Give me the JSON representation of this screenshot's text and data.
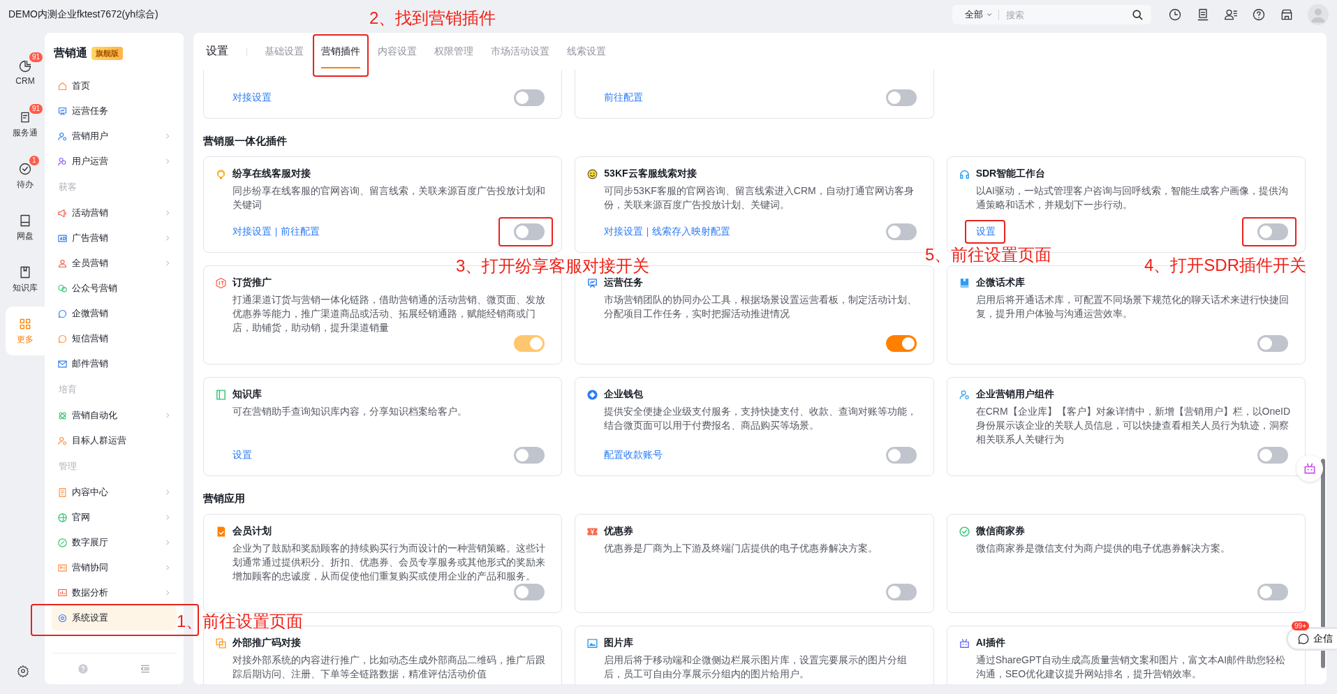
{
  "header": {
    "company": "DEMO内测企业fktest7672(yh综合)",
    "search": {
      "scope": "全部",
      "placeholder": "搜索"
    }
  },
  "rail": [
    {
      "label": "CRM",
      "badge": "91",
      "selected": false
    },
    {
      "label": "服务通",
      "badge": "91",
      "selected": false
    },
    {
      "label": "待办",
      "badge": "1",
      "selected": false
    },
    {
      "label": "网盘",
      "selected": false
    },
    {
      "label": "知识库",
      "selected": false
    },
    {
      "label": "更多",
      "selected": true
    }
  ],
  "nav": {
    "title": "营销通",
    "edition": "旗舰版",
    "groups": [
      {
        "items": [
          {
            "label": "首页",
            "expandable": false,
            "selected": false
          },
          {
            "label": "运营任务",
            "expandable": false,
            "selected": false
          },
          {
            "label": "营销用户",
            "expandable": true,
            "selected": false
          },
          {
            "label": "用户运营",
            "expandable": true,
            "selected": false
          }
        ]
      },
      {
        "label": "获客",
        "items": [
          {
            "label": "活动营销",
            "expandable": true,
            "selected": false
          },
          {
            "label": "广告营销",
            "expandable": true,
            "selected": false
          },
          {
            "label": "全员营销",
            "expandable": true,
            "selected": false
          },
          {
            "label": "公众号营销",
            "expandable": false,
            "selected": false
          },
          {
            "label": "企微营销",
            "expandable": false,
            "selected": false
          },
          {
            "label": "短信营销",
            "expandable": false,
            "selected": false
          },
          {
            "label": "邮件营销",
            "expandable": false,
            "selected": false
          }
        ]
      },
      {
        "label": "培育",
        "items": [
          {
            "label": "营销自动化",
            "expandable": true,
            "selected": false
          },
          {
            "label": "目标人群运营",
            "expandable": false,
            "selected": false
          }
        ]
      },
      {
        "label": "管理",
        "items": [
          {
            "label": "内容中心",
            "expandable": true,
            "selected": false
          },
          {
            "label": "官网",
            "expandable": true,
            "selected": false
          },
          {
            "label": "数字展厅",
            "expandable": true,
            "selected": false
          },
          {
            "label": "营销协同",
            "expandable": true,
            "selected": false
          },
          {
            "label": "数据分析",
            "expandable": true,
            "selected": false
          },
          {
            "label": "系统设置",
            "expandable": false,
            "selected": true,
            "marked": true
          }
        ]
      }
    ]
  },
  "tabs": {
    "title": "设置",
    "items": [
      {
        "label": "基础设置",
        "selected": false
      },
      {
        "label": "营销插件",
        "selected": true,
        "marked": true
      },
      {
        "label": "内容设置",
        "selected": false
      },
      {
        "label": "权限管理",
        "selected": false
      },
      {
        "label": "市场活动设置",
        "selected": false
      },
      {
        "label": "线索设置",
        "selected": false
      }
    ]
  },
  "sections": [
    {
      "clipped": true,
      "cards": [
        {
          "links": [
            {
              "text": "对接设置"
            }
          ],
          "toggle": {
            "on": false
          }
        },
        {
          "links": [
            {
              "text": "前往配置"
            }
          ],
          "toggle": {
            "on": false
          }
        }
      ]
    },
    {
      "title": "营销服一体化插件",
      "cards": [
        {
          "title": "纷享在线客服对接",
          "description": "同步纷享在线客服的官网咨询、留言线索，关联来源百度广告投放计划和关键词",
          "links": [
            {
              "text": "对接设置"
            },
            {
              "text": "前往配置"
            }
          ],
          "toggle": {
            "on": false,
            "marked": true
          }
        },
        {
          "title": "53KF云客服线索对接",
          "description": "可同步53KF客服的官网咨询、留言线索进入CRM，自动打通官网访客身份，关联来源百度广告投放计划、关键词。",
          "links": [
            {
              "text": "对接设置"
            },
            {
              "text": "线索存入映射配置"
            }
          ],
          "toggle": {
            "on": false
          }
        },
        {
          "title": "SDR智能工作台",
          "description": "以AI驱动，一站式管理客户咨询与回呼线索，智能生成客户画像，提供沟通策略和话术，并规划下一步行动。",
          "links": [
            {
              "text": "设置",
              "marked": true
            }
          ],
          "toggle": {
            "on": false,
            "marked": true
          }
        },
        {
          "title": "订货推广",
          "description": "打通渠道订货与营销一体化链路，借助营销通的活动营销、微页面、发放优惠券等能力，推广渠道商品或活动、拓展经销通路，赋能经销商或门店，助铺货，助动销，提升渠道销量",
          "toggle": {
            "on": true,
            "disabled": true
          }
        },
        {
          "title": "运营任务",
          "description": "市场营销团队的协同办公工具，根据场景设置运营看板，制定活动计划、分配项目工作任务，实时把握活动推进情况",
          "toggle": {
            "on": true
          }
        },
        {
          "title": "企微话术库",
          "description": "启用后将开通话术库，可配置不同场景下规范化的聊天话术来进行快捷回复，提升用户体验与沟通运营效率。",
          "toggle": {
            "on": false
          }
        },
        {
          "title": "知识库",
          "description": "可在营销助手查询知识库内容，分享知识档案给客户。",
          "links": [
            {
              "text": "设置"
            }
          ],
          "toggle": {
            "on": false
          }
        },
        {
          "title": "企业钱包",
          "description": "提供安全便捷企业级支付服务，支持快捷支付、收款、查询对账等功能，结合微页面可以用于付费报名、商品购买等场景。",
          "links": [
            {
              "text": "配置收款账号"
            }
          ],
          "toggle": {
            "on": false
          }
        },
        {
          "title": "企业营销用户组件",
          "description": "在CRM【企业库】【客户】对象详情中，新增【营销用户】栏，以OneID身份展示该企业的关联人员信息，可以快捷查看相关人员行为轨迹，洞察相关联系人关键行为",
          "toggle": {
            "on": false
          }
        }
      ]
    },
    {
      "title": "营销应用",
      "cards": [
        {
          "title": "会员计划",
          "description": "企业为了鼓励和奖励顾客的持续购买行为而设计的一种营销策略。这些计划通常通过提供积分、折扣、优惠券、会员专享服务或其他形式的奖励来增加顾客的忠诚度，从而促使他们重复购买或使用企业的产品和服务。",
          "toggle": {
            "on": false
          }
        },
        {
          "title": "优惠券",
          "description": "优惠券是厂商为上下游及终端门店提供的电子优惠券解决方案。",
          "toggle": {
            "on": false
          }
        },
        {
          "title": "微信商家券",
          "description": "微信商家券是微信支付为商户提供的电子优惠券解决方案。",
          "toggle": {
            "on": false
          }
        },
        {
          "title": "外部推广码对接",
          "description": "对接外部系统的内容进行推广，比如动态生成外部商品二维码，推广后跟踪后期访问、注册、下单等全链路数据，精准评估活动价值"
        },
        {
          "title": "图片库",
          "description": "启用后将于移动端和企微侧边栏展示图片库，设置完要展示的图片分组后，员工可自由分享展示分组内的图片给用户。"
        },
        {
          "title": "AI插件",
          "description": "通过ShareGPT自动生成高质量营销文案和图片，富文本AI邮件助您轻松沟通，SEO优化建议提升网站排名，提升营销效率。"
        }
      ]
    }
  ],
  "annotations": [
    "2、找到营销插件",
    "3、打开纷享客服对接开关",
    "5、前往设置页面",
    "4、打开SDR插件开关",
    "1、前往设置页面"
  ],
  "chat": {
    "label": "企信",
    "badge": "99+"
  }
}
